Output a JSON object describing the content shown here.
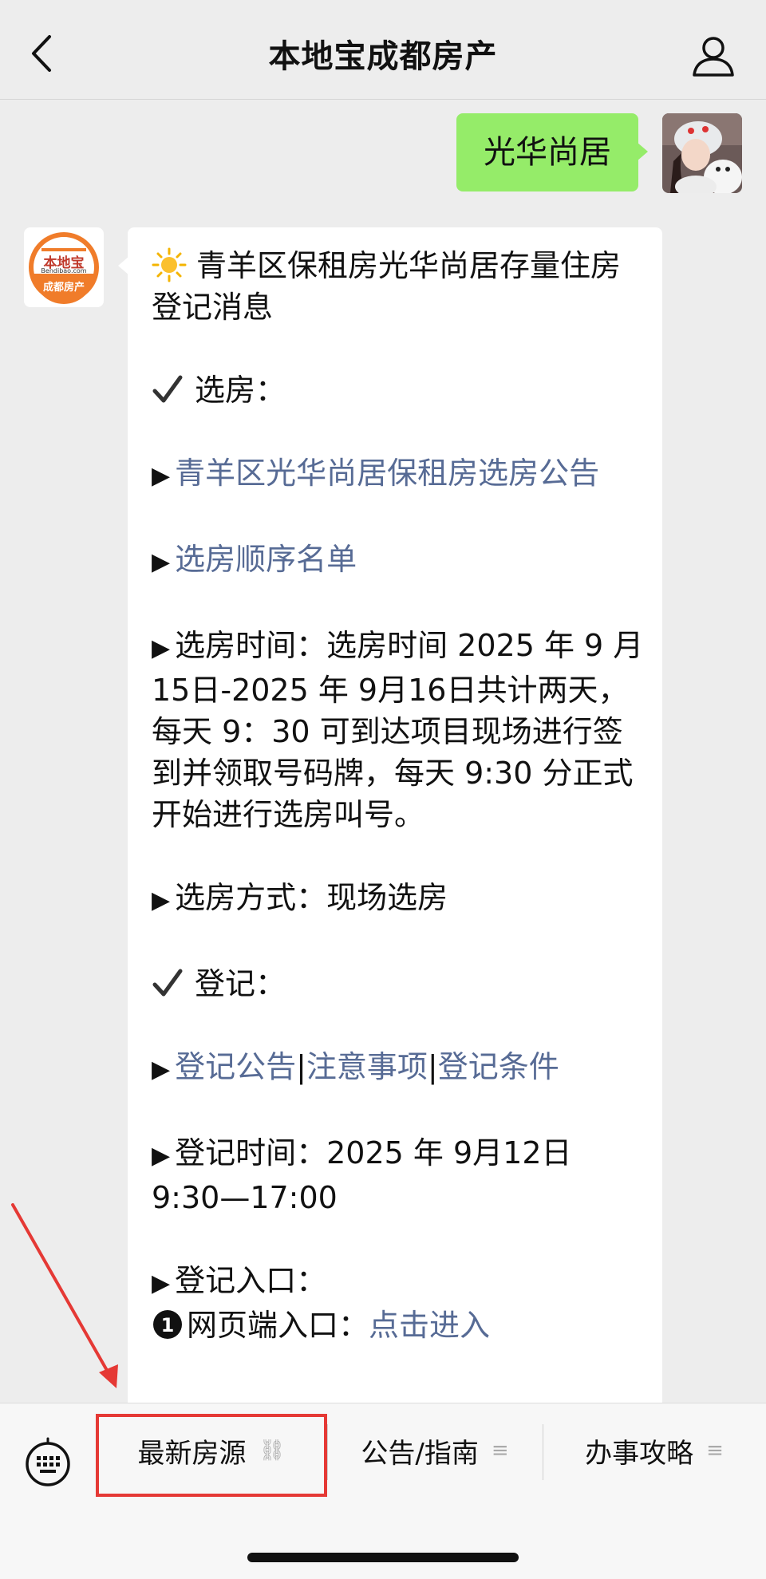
{
  "nav": {
    "title": "本地宝成都房产"
  },
  "chat": {
    "sent_message": "光华尚居",
    "bot_logo": {
      "line1": "本地宝",
      "line2": "Bendibao.com",
      "line3": "成都房产"
    },
    "lines": {
      "title": "青羊区保租房光华尚居存量住房登记消息",
      "section1": "选房：",
      "link_notice": "青羊区光华尚居保租房选房公告",
      "link_order": "选房顺序名单",
      "time_label": "选房时间：",
      "time_text": "选房时间 2025 年 9 月15日-2025 年 9月16日共计两天，每天 9：30 可到达项目现场进行签到并领取号码牌，每天 9:30 分正式开始进行选房叫号。",
      "method": "选房方式：现场选房",
      "section2": "登记：",
      "link_reg_notice": "登记公告",
      "link_reg_attention": "注意事项",
      "link_reg_condition": "登记条件",
      "reg_time_label": "登记时间：",
      "reg_time_text": "2025 年 9月12日 9:30—17:00",
      "reg_entry": "登记入口：",
      "web_entry": "网页端入口：",
      "web_link": "点击进入"
    }
  },
  "menu": [
    {
      "label": "最新房源",
      "icon": "link-icon"
    },
    {
      "label": "公告/指南",
      "icon": "menu-icon"
    },
    {
      "label": "办事攻略",
      "icon": "menu-icon"
    }
  ],
  "colors": {
    "accent_red": "#e53935",
    "link": "#576b95",
    "bubble_green": "#95ec69"
  }
}
